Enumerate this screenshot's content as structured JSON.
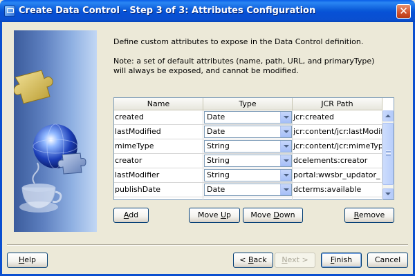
{
  "window": {
    "title": "Create Data Control - Step 3 of 3: Attributes Configuration",
    "close_glyph": "✕"
  },
  "content": {
    "description": "Define custom attributes to expose in the Data Control definition.",
    "note_line1": "Note: a set of default attributes (name, path, URL, and primaryType)",
    "note_line2": "will always be exposed, and cannot be modified."
  },
  "table": {
    "columns": [
      "Name",
      "Type",
      "JCR Path"
    ],
    "rows": [
      {
        "name": "created",
        "type": "Date",
        "path": "jcr:created"
      },
      {
        "name": "lastModified",
        "type": "Date",
        "path": "jcr:content/jcr:lastModified"
      },
      {
        "name": "mimeType",
        "type": "String",
        "path": "jcr:content/jcr:mimeType"
      },
      {
        "name": "creator",
        "type": "String",
        "path": "dcelements:creator"
      },
      {
        "name": "lastModifier",
        "type": "String",
        "path": "portal:wwsbr_updator_"
      },
      {
        "name": "publishDate",
        "type": "Date",
        "path": "dcterms:available"
      }
    ]
  },
  "table_buttons": {
    "add": {
      "pre": "",
      "ul": "A",
      "post": "dd"
    },
    "move_up": {
      "pre": "Move ",
      "ul": "U",
      "post": "p"
    },
    "move_down": {
      "pre": "Move ",
      "ul": "D",
      "post": "own"
    },
    "remove": {
      "pre": "",
      "ul": "R",
      "post": "emove"
    }
  },
  "footer": {
    "help": {
      "pre": "",
      "ul": "H",
      "post": "elp"
    },
    "back": {
      "pre": "< ",
      "ul": "B",
      "post": "ack"
    },
    "next": {
      "pre": "",
      "ul": "N",
      "post": "ext >"
    },
    "finish": {
      "pre": "",
      "ul": "F",
      "post": "inish"
    },
    "cancel": {
      "pre": "Cancel",
      "ul": "",
      "post": ""
    }
  },
  "icons": {
    "side": "data-control-wizard-graphic",
    "title": "window-icon"
  },
  "colors": {
    "titlebar": "#0A4FD0",
    "dialog_bg": "#ECE9D8",
    "button_border": "#003C74",
    "close_button": "#D1512C"
  }
}
